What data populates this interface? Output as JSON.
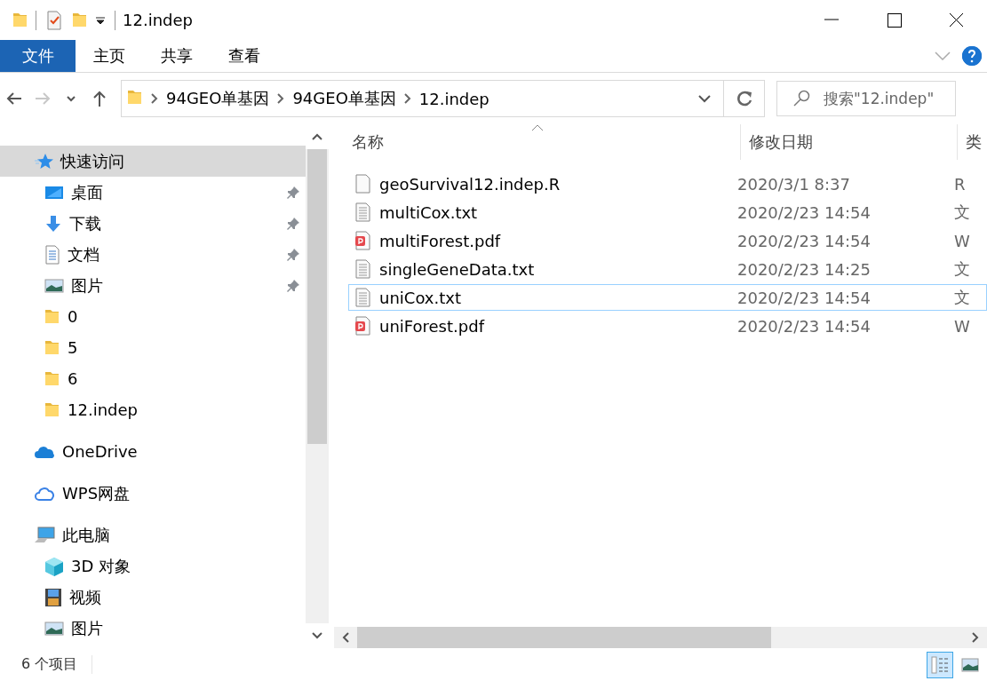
{
  "window": {
    "title": "12.indep"
  },
  "ribbon": {
    "tabs": [
      {
        "label": "文件",
        "kind": "file",
        "selected": false
      },
      {
        "label": "主页",
        "kind": "tab",
        "selected": false
      },
      {
        "label": "共享",
        "kind": "tab",
        "selected": false
      },
      {
        "label": "查看",
        "kind": "tab",
        "selected": false
      }
    ]
  },
  "navigation": [
    {
      "kind": "back",
      "disabled": false
    },
    {
      "kind": "forward",
      "disabled": true
    },
    {
      "kind": "recent",
      "disabled": false
    },
    {
      "kind": "up",
      "disabled": false
    }
  ],
  "address": {
    "path": [
      "94GEO单基因",
      "94GEO单基因",
      "12.indep"
    ]
  },
  "search": {
    "placeholder": "搜索\"12.indep\""
  },
  "sidebar": {
    "items": [
      {
        "label": "快速访问",
        "kind": "quick",
        "selected": true,
        "children": [
          {
            "label": "桌面",
            "kind": "desktop",
            "pinned": true,
            "selected": false
          },
          {
            "label": "下载",
            "kind": "download",
            "pinned": true,
            "selected": false
          },
          {
            "label": "文档",
            "kind": "docs",
            "pinned": true,
            "selected": false
          },
          {
            "label": "图片",
            "kind": "pictures",
            "pinned": true,
            "selected": false
          },
          {
            "label": "0",
            "kind": "folder",
            "pinned": false,
            "selected": false
          },
          {
            "label": "5",
            "kind": "folder",
            "pinned": false,
            "selected": false
          },
          {
            "label": "6",
            "kind": "folder",
            "pinned": false,
            "selected": false
          },
          {
            "label": "12.indep",
            "kind": "folder",
            "pinned": false,
            "selected": false
          }
        ]
      },
      {
        "label": "OneDrive",
        "kind": "onedrive",
        "selected": false
      },
      {
        "label": "WPS网盘",
        "kind": "wps",
        "selected": false
      },
      {
        "label": "此电脑",
        "kind": "pc",
        "selected": false,
        "children": [
          {
            "label": "3D 对象",
            "kind": "cube",
            "pinned": false,
            "selected": false
          },
          {
            "label": "视频",
            "kind": "video",
            "pinned": false,
            "selected": false
          },
          {
            "label": "图片",
            "kind": "pictures",
            "pinned": false,
            "selected": false
          }
        ]
      }
    ]
  },
  "file_list": {
    "columns": [
      {
        "label": "名称",
        "sorted": true
      },
      {
        "label": "修改日期",
        "sorted": false
      },
      {
        "label": "类",
        "sorted": false
      }
    ],
    "rows": [
      {
        "name": "geoSurvival12.indep.R",
        "date": "2020/3/1 8:37",
        "column_3": "R",
        "kind": "r",
        "focused": false
      },
      {
        "name": "multiCox.txt",
        "date": "2020/2/23 14:54",
        "column_3": "文",
        "kind": "txt",
        "focused": false
      },
      {
        "name": "multiForest.pdf",
        "date": "2020/2/23 14:54",
        "column_3": "W",
        "kind": "pdf",
        "focused": false
      },
      {
        "name": "singleGeneData.txt",
        "date": "2020/2/23 14:25",
        "column_3": "文",
        "kind": "txt",
        "focused": false
      },
      {
        "name": "uniCox.txt",
        "date": "2020/2/23 14:54",
        "column_3": "文",
        "kind": "txt",
        "focused": true
      },
      {
        "name": "uniForest.pdf",
        "date": "2020/2/23 14:54",
        "column_3": "W",
        "kind": "pdf",
        "focused": false
      }
    ]
  },
  "status_bar": {
    "item_count": "6 个项目"
  },
  "view_buttons": [
    {
      "kind": "details",
      "selected": true
    },
    {
      "kind": "large_icons",
      "selected": false
    }
  ]
}
